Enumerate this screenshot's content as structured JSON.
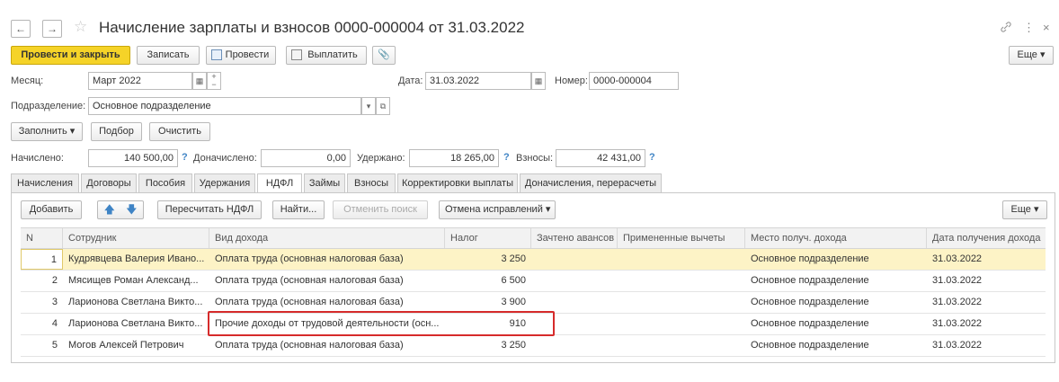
{
  "window": {
    "title": "Начисление зарплаты и взносов 0000-000004 от 31.03.2022",
    "back_glyph": "←",
    "forward_glyph": "→",
    "star_glyph": "☆",
    "link_glyph": "🔗",
    "more_glyph": "⋮",
    "close_glyph": "×"
  },
  "toolbar": {
    "post_close": "Провести и закрыть",
    "save": "Записать",
    "post": "Провести",
    "pay": "Выплатить",
    "attach_glyph": "📎",
    "more": "Еще ▾"
  },
  "form": {
    "month_label": "Месяц:",
    "month_value": "Март 2022",
    "date_label": "Дата:",
    "date_value": "31.03.2022",
    "number_label": "Номер:",
    "number_value": "0000-000004",
    "dept_label": "Подразделение:",
    "dept_value": "Основное подразделение"
  },
  "actions": {
    "fill": "Заполнить ▾",
    "select": "Подбор",
    "clear": "Очистить"
  },
  "totals": {
    "accrued_label": "Начислено:",
    "accrued_value": "140 500,00",
    "additional_label": "Доначислено:",
    "additional_value": "0,00",
    "withheld_label": "Удержано:",
    "withheld_value": "18 265,00",
    "contributions_label": "Взносы:",
    "contributions_value": "42 431,00",
    "help": "?"
  },
  "tabs": [
    {
      "label": "Начисления"
    },
    {
      "label": "Договоры"
    },
    {
      "label": "Пособия"
    },
    {
      "label": "Удержания"
    },
    {
      "label": "НДФЛ"
    },
    {
      "label": "Займы"
    },
    {
      "label": "Взносы"
    },
    {
      "label": "Корректировки выплаты"
    },
    {
      "label": "Доначисления, перерасчеты"
    }
  ],
  "ndfl_toolbar": {
    "add": "Добавить",
    "recalc": "Пересчитать НДФЛ",
    "find": "Найти...",
    "cancel_search": "Отменить поиск",
    "cancel_corrections": "Отмена исправлений ▾",
    "more": "Еще ▾"
  },
  "table": {
    "columns": [
      "N",
      "Сотрудник",
      "Вид дохода",
      "Налог",
      "Зачтено авансов",
      "Примененные вычеты",
      "Место получ. дохода",
      "Дата получения дохода"
    ],
    "rows": [
      {
        "n": "1",
        "employee": "Кудрявцева Валерия Ивано...",
        "income": "Оплата труда (основная налоговая база)",
        "tax": "3 250",
        "advances": "",
        "deductions": "",
        "place": "Основное подразделение",
        "date": "31.03.2022"
      },
      {
        "n": "2",
        "employee": "Мясищев Роман Александ...",
        "income": "Оплата труда (основная налоговая база)",
        "tax": "6 500",
        "advances": "",
        "deductions": "",
        "place": "Основное подразделение",
        "date": "31.03.2022"
      },
      {
        "n": "3",
        "employee": "Ларионова Светлана Викто...",
        "income": "Оплата труда (основная налоговая база)",
        "tax": "3 900",
        "advances": "",
        "deductions": "",
        "place": "Основное подразделение",
        "date": "31.03.2022"
      },
      {
        "n": "4",
        "employee": "Ларионова Светлана Викто...",
        "income": "Прочие доходы от трудовой деятельности (осн...",
        "tax": "910",
        "advances": "",
        "deductions": "",
        "place": "Основное подразделение",
        "date": "31.03.2022"
      },
      {
        "n": "5",
        "employee": "Могов Алексей Петрович",
        "income": "Оплата труда (основная налоговая база)",
        "tax": "3 250",
        "advances": "",
        "deductions": "",
        "place": "Основное подразделение",
        "date": "31.03.2022"
      }
    ]
  },
  "colors": {
    "primary_button": "#f5d328",
    "selected_row": "#fdf3c6",
    "highlight_border": "#d62b2b",
    "help": "#3f84c5"
  }
}
